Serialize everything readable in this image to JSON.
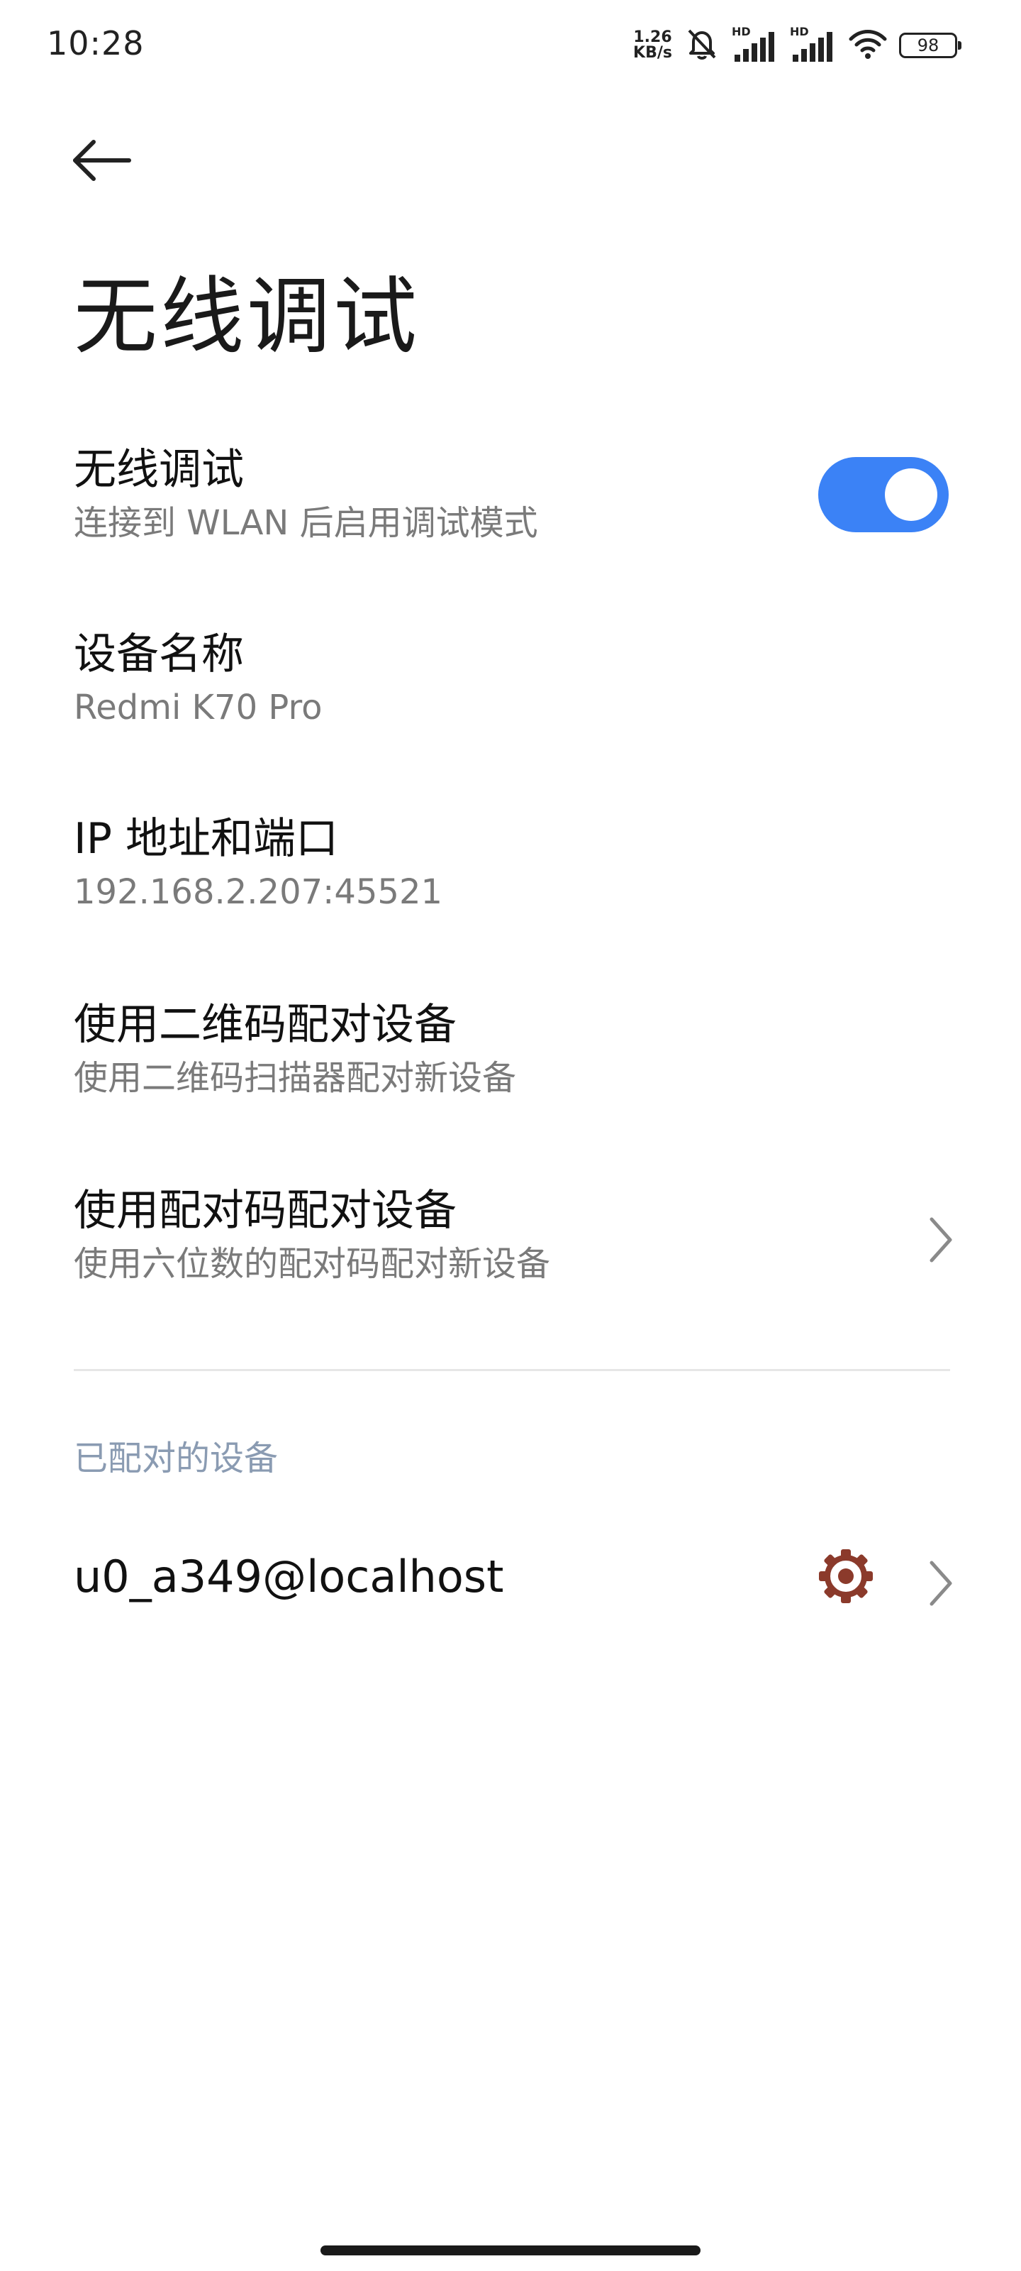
{
  "status_bar": {
    "time": "10:28",
    "net_speed_value": "1.26",
    "net_speed_unit": "KB/s",
    "hd_label_1": "HD",
    "hd_label_2": "HD",
    "battery": "98"
  },
  "header": {
    "title": "无线调试"
  },
  "settings": {
    "wireless_debugging": {
      "title": "无线调试",
      "subtitle": "连接到 WLAN 后启用调试模式",
      "enabled": true
    },
    "device_name": {
      "title": "设备名称",
      "value": "Redmi K70 Pro"
    },
    "ip_port": {
      "title": "IP 地址和端口",
      "value": "192.168.2.207:45521"
    },
    "pair_qr": {
      "title": "使用二维码配对设备",
      "subtitle": "使用二维码扫描器配对新设备"
    },
    "pair_code": {
      "title": "使用配对码配对设备",
      "subtitle": "使用六位数的配对码配对新设备"
    }
  },
  "paired_devices": {
    "header": "已配对的设备",
    "items": [
      {
        "name": "u0_a349@localhost"
      }
    ]
  },
  "colors": {
    "accent": "#3b82f6",
    "section_header": "#8a9bb2",
    "gear": "#8b3a2b"
  },
  "icons": {
    "back": "arrow-left-icon",
    "chevron": "chevron-right-icon",
    "settings": "gear-icon",
    "wifi": "wifi-icon",
    "signal": "signal-icon",
    "mute": "bell-off-icon"
  }
}
